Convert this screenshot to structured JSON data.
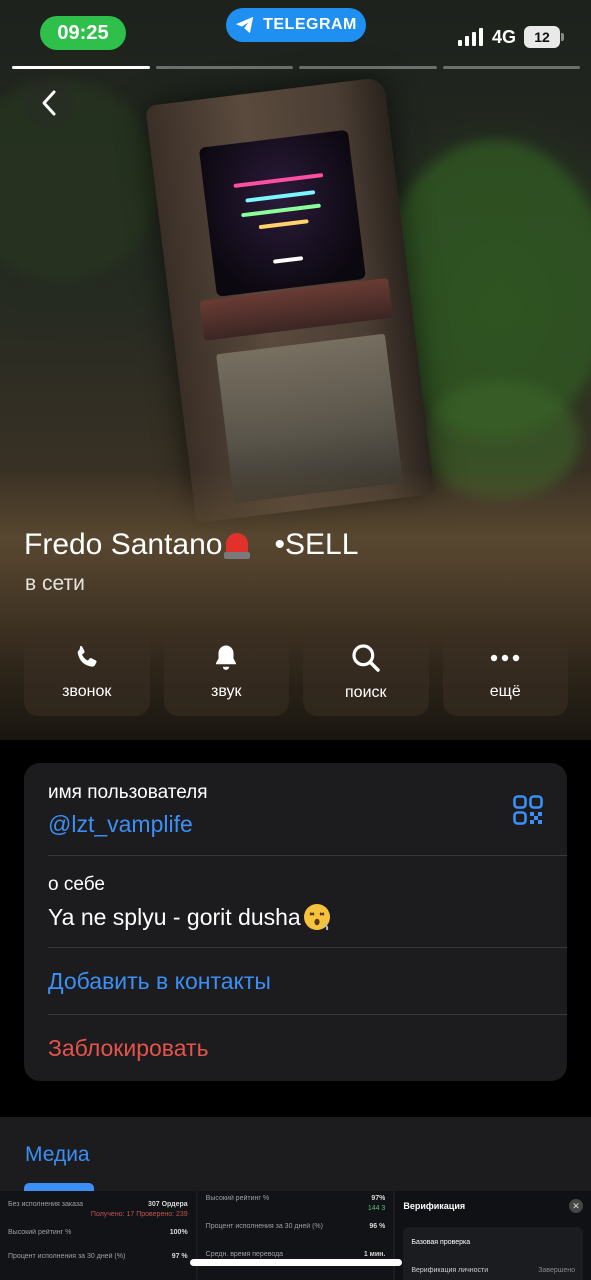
{
  "status_bar": {
    "time": "09:25",
    "app_badge": "TELEGRAM",
    "network": "4G",
    "battery": "12"
  },
  "profile": {
    "name": "Fredo Santano",
    "name_suffix": "•SELL",
    "status": "в сети"
  },
  "actions": [
    {
      "label": "звонок",
      "icon": "phone-icon"
    },
    {
      "label": "звук",
      "icon": "bell-icon"
    },
    {
      "label": "поиск",
      "icon": "search-icon"
    },
    {
      "label": "ещё",
      "icon": "more-icon"
    }
  ],
  "info": {
    "username_label": "имя пользователя",
    "username": "@lzt_vamplife",
    "bio_label": "о себе",
    "bio": "Ya ne splyu - gorit dusha",
    "add_contact": "Добавить в контакты",
    "block": "Заблокировать"
  },
  "media": {
    "title": "Медиа",
    "thumb1": {
      "r1_label": "Без исполнения заказа",
      "r1_value": "307 Ордера",
      "r1_sub": "Получено: 17   Проверено: 239",
      "r2_label": "Высокий рейтинг %",
      "r2_value": "100%",
      "r3_label": "Процент исполнения за 30 дней (%)",
      "r3_value": "97 %"
    },
    "thumb2": {
      "r1_label": "Высокий рейтинг %",
      "r1_value": "97%",
      "r1_sub": "144   3",
      "r2_label": "Процент исполнения за 30 дней (%)",
      "r2_value": "96 %",
      "r3_label": "Средн. время перевода",
      "r3_value": "1 мин."
    },
    "thumb3": {
      "title": "Верификация",
      "item1": "Базовая проверка",
      "item2": "Верификация личности",
      "item2_value": "Завершено"
    }
  },
  "colors": {
    "accent": "#3b8ff5",
    "danger": "#e5534b",
    "time_pill": "#2ec04a",
    "telegram_pill": "#1f8ff2",
    "card_bg": "#1c1c1e"
  }
}
